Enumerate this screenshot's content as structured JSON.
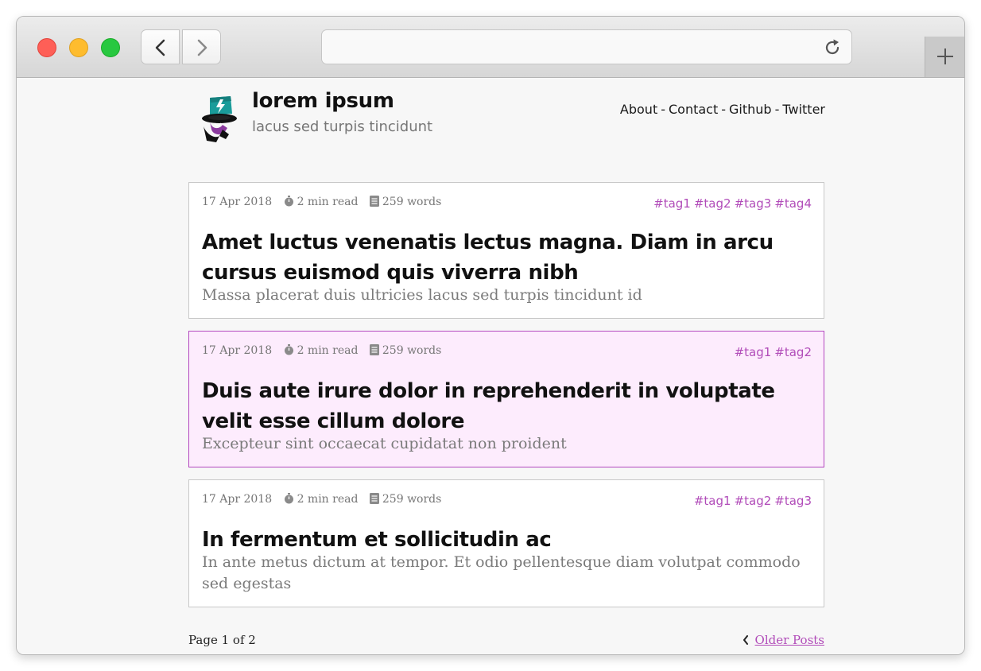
{
  "browser": {
    "url": ""
  },
  "site": {
    "title": "lorem ipsum",
    "subtitle": "lacus sed turpis tincidunt",
    "nav": [
      "About",
      "Contact",
      "Github",
      "Twitter"
    ],
    "nav_separator": "-"
  },
  "posts": [
    {
      "date": "17 Apr 2018",
      "read_time": "2 min read",
      "words": "259 words",
      "tags": [
        "#tag1",
        "#tag2",
        "#tag3",
        "#tag4"
      ],
      "title": "Amet luctus venenatis lectus magna. Diam in arcu cursus euismod quis viverra nibh",
      "subtitle": "Massa placerat duis ultricies lacus sed turpis tincidunt id",
      "highlighted": false
    },
    {
      "date": "17 Apr 2018",
      "read_time": "2 min read",
      "words": "259 words",
      "tags": [
        "#tag1",
        "#tag2"
      ],
      "title": "Duis aute irure dolor in reprehenderit in voluptate velit esse cillum dolore",
      "subtitle": "Excepteur sint occaecat cupidatat non proident",
      "highlighted": true
    },
    {
      "date": "17 Apr 2018",
      "read_time": "2 min read",
      "words": "259 words",
      "tags": [
        "#tag1",
        "#tag2",
        "#tag3"
      ],
      "title": "In fermentum et sollicitudin ac",
      "subtitle": "In ante metus dictum at tempor. Et odio pellentesque diam volutpat commodo sed egestas",
      "highlighted": false
    }
  ],
  "pagination": {
    "status": "Page 1 of 2",
    "older_label": "Older Posts"
  },
  "colors": {
    "accent": "#b14cb9",
    "highlight_bg": "#fdecfd"
  },
  "icons": [
    "back-arrow-icon",
    "forward-arrow-icon",
    "reload-icon",
    "plus-icon",
    "stopwatch-icon",
    "document-icon",
    "chevron-left-icon",
    "site-logo"
  ]
}
